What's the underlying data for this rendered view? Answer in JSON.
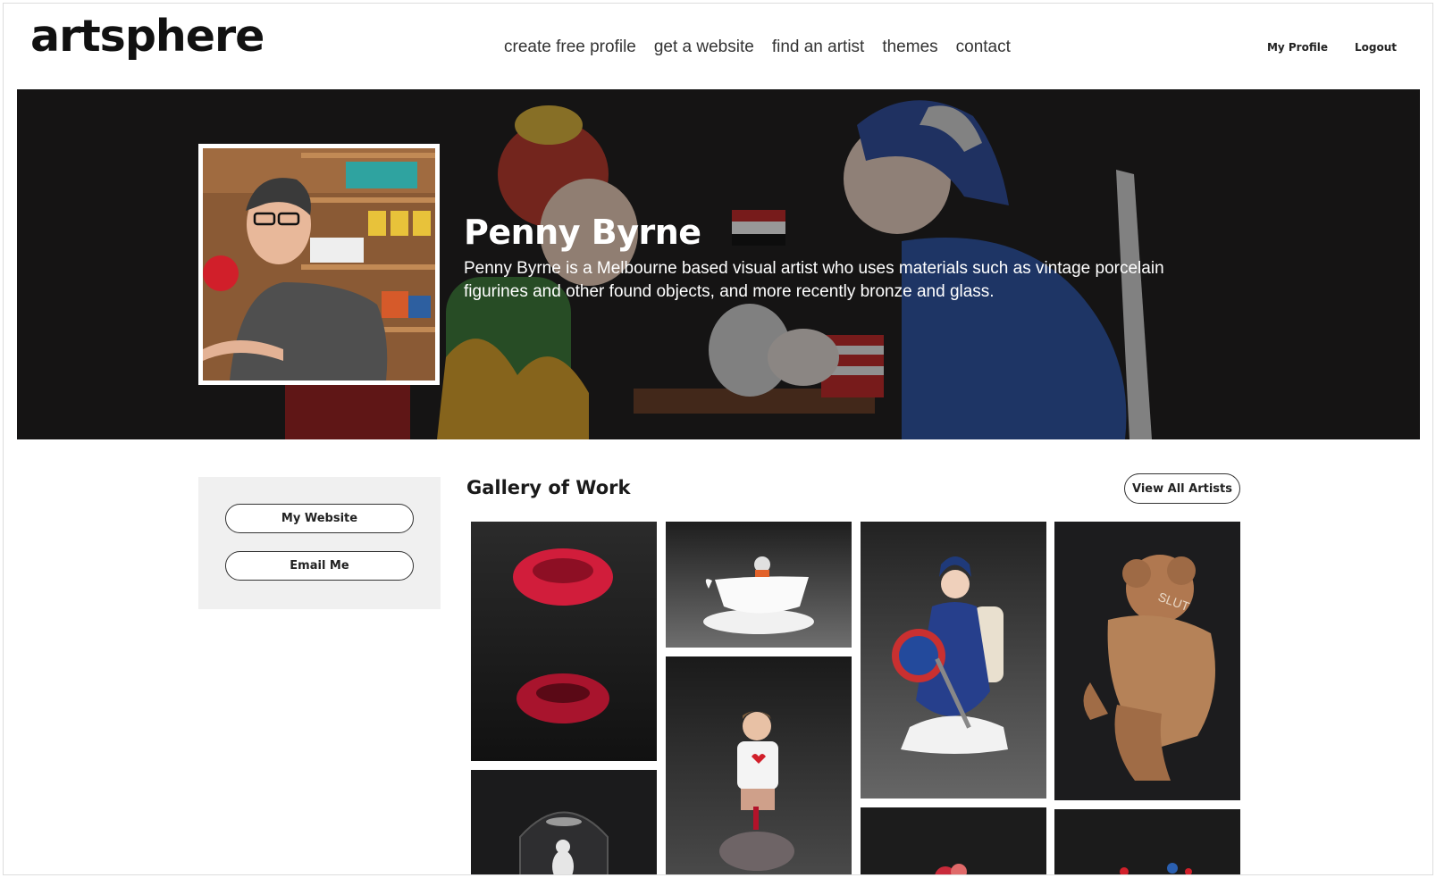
{
  "brand": {
    "logo_text": "artsphere"
  },
  "nav": {
    "items": [
      {
        "label": "create free profile"
      },
      {
        "label": "get a website"
      },
      {
        "label": "find an artist"
      },
      {
        "label": "themes"
      },
      {
        "label": "contact"
      }
    ]
  },
  "account": {
    "profile_label": "My Profile",
    "logout_label": "Logout"
  },
  "hero": {
    "name": "Penny Byrne",
    "bio": "Penny Byrne is a Melbourne based visual artist who uses materials such as vintage porcelain figurines and other found objects, and more recently bronze and glass."
  },
  "sidebar": {
    "website_label": "My Website",
    "email_label": "Email Me"
  },
  "gallery": {
    "title": "Gallery of Work",
    "view_all_label": "View All Artists"
  },
  "colors": {
    "hero_bg": "#1e1c1d",
    "sidebar_bg": "#f0f0f0",
    "accent_red": "#d3142f",
    "tile_dark": "#2a2a2c"
  }
}
